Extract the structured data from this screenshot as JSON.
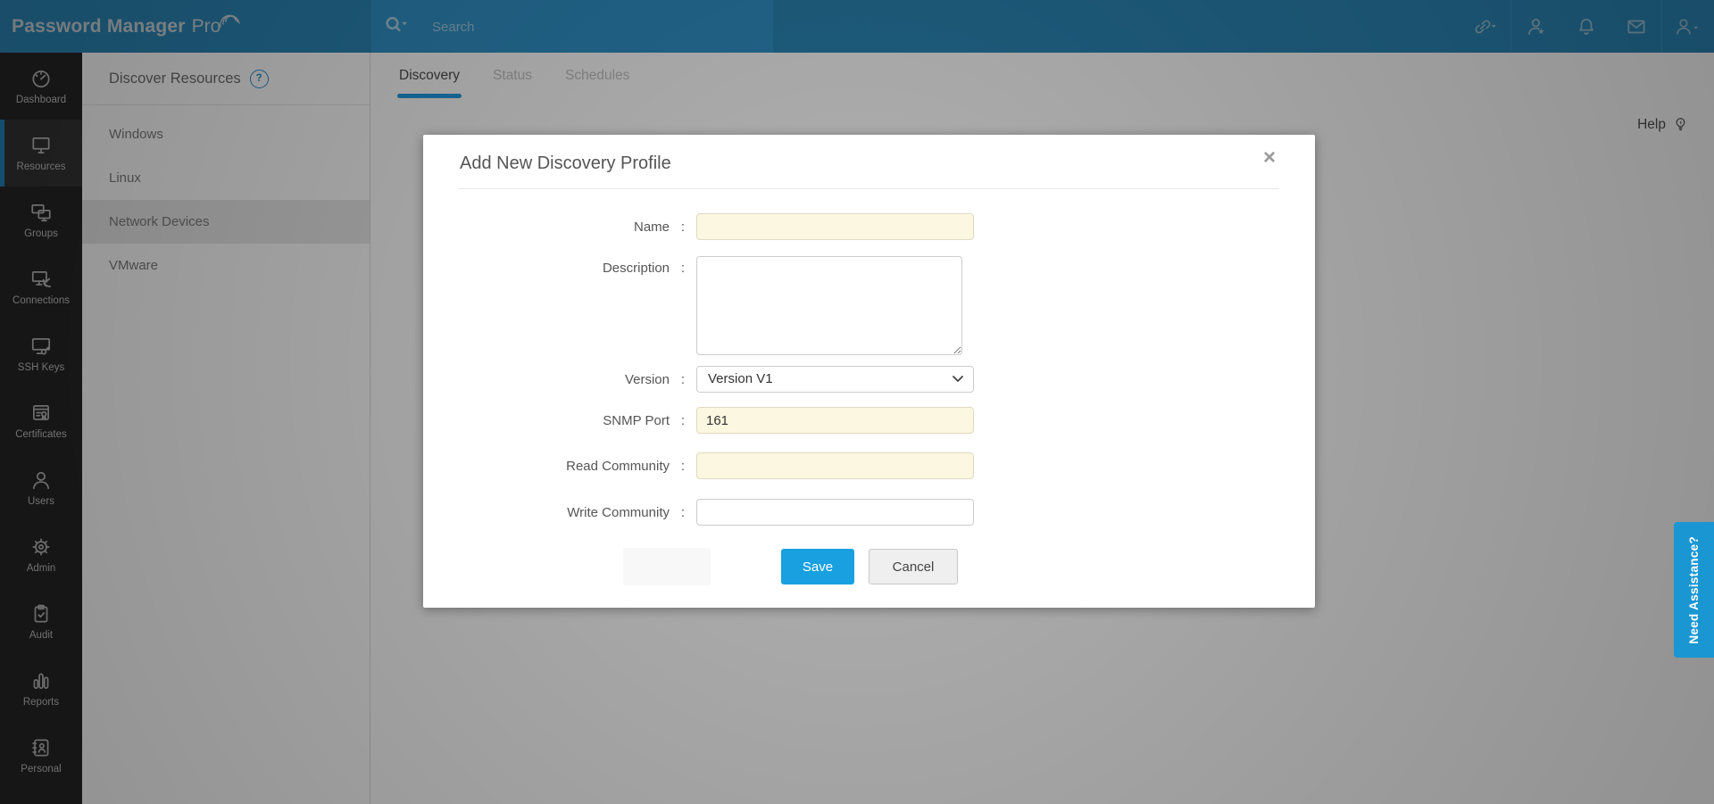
{
  "brand": {
    "name_bold": "Password Manager",
    "name_light": "Pro"
  },
  "topbar": {
    "search_placeholder": "Search",
    "icons": [
      "link",
      "user-favorite",
      "notifications",
      "mail",
      "account"
    ]
  },
  "sidebar": {
    "items": [
      {
        "label": "Dashboard"
      },
      {
        "label": "Resources",
        "active": true
      },
      {
        "label": "Groups"
      },
      {
        "label": "Connections"
      },
      {
        "label": "SSH Keys"
      },
      {
        "label": "Certificates"
      },
      {
        "label": "Users"
      },
      {
        "label": "Admin"
      },
      {
        "label": "Audit"
      },
      {
        "label": "Reports"
      },
      {
        "label": "Personal"
      }
    ]
  },
  "subsidebar": {
    "title": "Discover Resources",
    "help_badge": "?",
    "items": [
      {
        "label": "Windows"
      },
      {
        "label": "Linux"
      },
      {
        "label": "Network Devices",
        "active": true
      },
      {
        "label": "VMware"
      }
    ]
  },
  "main": {
    "tabs": [
      {
        "label": "Discovery",
        "active": true
      },
      {
        "label": "Status"
      },
      {
        "label": "Schedules"
      }
    ],
    "help_label": "Help"
  },
  "modal": {
    "title": "Add New Discovery Profile",
    "close_label": "×",
    "colon": ":",
    "fields": {
      "name": {
        "label": "Name",
        "value": ""
      },
      "description": {
        "label": "Description",
        "value": ""
      },
      "version": {
        "label": "Version",
        "value": "Version V1"
      },
      "snmp_port": {
        "label": "SNMP Port",
        "value": "161"
      },
      "read_community": {
        "label": "Read Community",
        "value": ""
      },
      "write_community": {
        "label": "Write Community",
        "value": ""
      }
    },
    "buttons": {
      "save": "Save",
      "cancel": "Cancel"
    }
  },
  "assistance_label": "Need Assistance?",
  "colors": {
    "topbar": "#2b86b6",
    "search_bar": "#3192c8",
    "sidebar": "#262626",
    "accent": "#1f9ce0",
    "save_blue": "#18a0e0",
    "assist_blue": "#1a97d2",
    "input_highlight": "#fcf7e1"
  }
}
